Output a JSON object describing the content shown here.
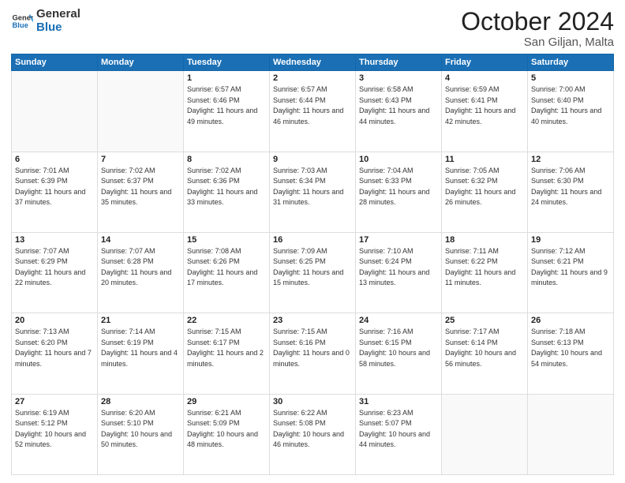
{
  "header": {
    "logo_line1": "General",
    "logo_line2": "Blue",
    "month": "October 2024",
    "location": "San Giljan, Malta"
  },
  "weekdays": [
    "Sunday",
    "Monday",
    "Tuesday",
    "Wednesday",
    "Thursday",
    "Friday",
    "Saturday"
  ],
  "weeks": [
    [
      {
        "day": "",
        "info": ""
      },
      {
        "day": "",
        "info": ""
      },
      {
        "day": "1",
        "info": "Sunrise: 6:57 AM\nSunset: 6:46 PM\nDaylight: 11 hours and 49 minutes."
      },
      {
        "day": "2",
        "info": "Sunrise: 6:57 AM\nSunset: 6:44 PM\nDaylight: 11 hours and 46 minutes."
      },
      {
        "day": "3",
        "info": "Sunrise: 6:58 AM\nSunset: 6:43 PM\nDaylight: 11 hours and 44 minutes."
      },
      {
        "day": "4",
        "info": "Sunrise: 6:59 AM\nSunset: 6:41 PM\nDaylight: 11 hours and 42 minutes."
      },
      {
        "day": "5",
        "info": "Sunrise: 7:00 AM\nSunset: 6:40 PM\nDaylight: 11 hours and 40 minutes."
      }
    ],
    [
      {
        "day": "6",
        "info": "Sunrise: 7:01 AM\nSunset: 6:39 PM\nDaylight: 11 hours and 37 minutes."
      },
      {
        "day": "7",
        "info": "Sunrise: 7:02 AM\nSunset: 6:37 PM\nDaylight: 11 hours and 35 minutes."
      },
      {
        "day": "8",
        "info": "Sunrise: 7:02 AM\nSunset: 6:36 PM\nDaylight: 11 hours and 33 minutes."
      },
      {
        "day": "9",
        "info": "Sunrise: 7:03 AM\nSunset: 6:34 PM\nDaylight: 11 hours and 31 minutes."
      },
      {
        "day": "10",
        "info": "Sunrise: 7:04 AM\nSunset: 6:33 PM\nDaylight: 11 hours and 28 minutes."
      },
      {
        "day": "11",
        "info": "Sunrise: 7:05 AM\nSunset: 6:32 PM\nDaylight: 11 hours and 26 minutes."
      },
      {
        "day": "12",
        "info": "Sunrise: 7:06 AM\nSunset: 6:30 PM\nDaylight: 11 hours and 24 minutes."
      }
    ],
    [
      {
        "day": "13",
        "info": "Sunrise: 7:07 AM\nSunset: 6:29 PM\nDaylight: 11 hours and 22 minutes."
      },
      {
        "day": "14",
        "info": "Sunrise: 7:07 AM\nSunset: 6:28 PM\nDaylight: 11 hours and 20 minutes."
      },
      {
        "day": "15",
        "info": "Sunrise: 7:08 AM\nSunset: 6:26 PM\nDaylight: 11 hours and 17 minutes."
      },
      {
        "day": "16",
        "info": "Sunrise: 7:09 AM\nSunset: 6:25 PM\nDaylight: 11 hours and 15 minutes."
      },
      {
        "day": "17",
        "info": "Sunrise: 7:10 AM\nSunset: 6:24 PM\nDaylight: 11 hours and 13 minutes."
      },
      {
        "day": "18",
        "info": "Sunrise: 7:11 AM\nSunset: 6:22 PM\nDaylight: 11 hours and 11 minutes."
      },
      {
        "day": "19",
        "info": "Sunrise: 7:12 AM\nSunset: 6:21 PM\nDaylight: 11 hours and 9 minutes."
      }
    ],
    [
      {
        "day": "20",
        "info": "Sunrise: 7:13 AM\nSunset: 6:20 PM\nDaylight: 11 hours and 7 minutes."
      },
      {
        "day": "21",
        "info": "Sunrise: 7:14 AM\nSunset: 6:19 PM\nDaylight: 11 hours and 4 minutes."
      },
      {
        "day": "22",
        "info": "Sunrise: 7:15 AM\nSunset: 6:17 PM\nDaylight: 11 hours and 2 minutes."
      },
      {
        "day": "23",
        "info": "Sunrise: 7:15 AM\nSunset: 6:16 PM\nDaylight: 11 hours and 0 minutes."
      },
      {
        "day": "24",
        "info": "Sunrise: 7:16 AM\nSunset: 6:15 PM\nDaylight: 10 hours and 58 minutes."
      },
      {
        "day": "25",
        "info": "Sunrise: 7:17 AM\nSunset: 6:14 PM\nDaylight: 10 hours and 56 minutes."
      },
      {
        "day": "26",
        "info": "Sunrise: 7:18 AM\nSunset: 6:13 PM\nDaylight: 10 hours and 54 minutes."
      }
    ],
    [
      {
        "day": "27",
        "info": "Sunrise: 6:19 AM\nSunset: 5:12 PM\nDaylight: 10 hours and 52 minutes."
      },
      {
        "day": "28",
        "info": "Sunrise: 6:20 AM\nSunset: 5:10 PM\nDaylight: 10 hours and 50 minutes."
      },
      {
        "day": "29",
        "info": "Sunrise: 6:21 AM\nSunset: 5:09 PM\nDaylight: 10 hours and 48 minutes."
      },
      {
        "day": "30",
        "info": "Sunrise: 6:22 AM\nSunset: 5:08 PM\nDaylight: 10 hours and 46 minutes."
      },
      {
        "day": "31",
        "info": "Sunrise: 6:23 AM\nSunset: 5:07 PM\nDaylight: 10 hours and 44 minutes."
      },
      {
        "day": "",
        "info": ""
      },
      {
        "day": "",
        "info": ""
      }
    ]
  ]
}
